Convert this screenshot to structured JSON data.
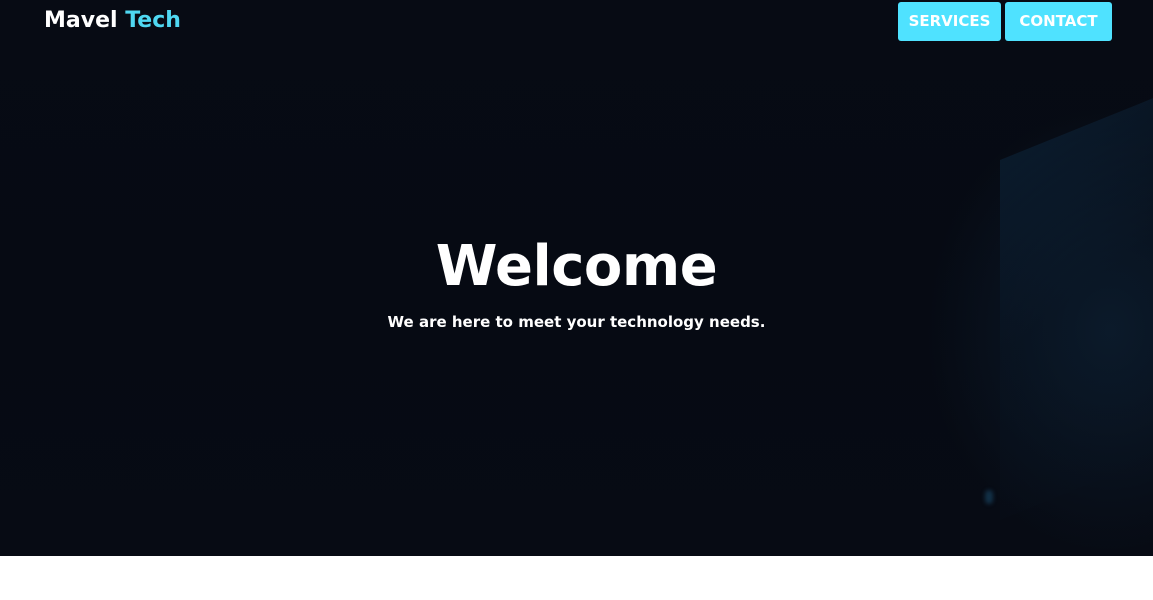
{
  "brand": {
    "name_main": "Mavel",
    "name_accent": "Tech",
    "accent_color": "#4fd8f2"
  },
  "nav": {
    "services_label": "SERVICES",
    "contact_label": "CONTACT",
    "button_color": "#4fe2ff"
  },
  "hero": {
    "title": "Welcome",
    "subtitle": "We are here to meet your technology needs.",
    "background_color": "#070b14"
  }
}
